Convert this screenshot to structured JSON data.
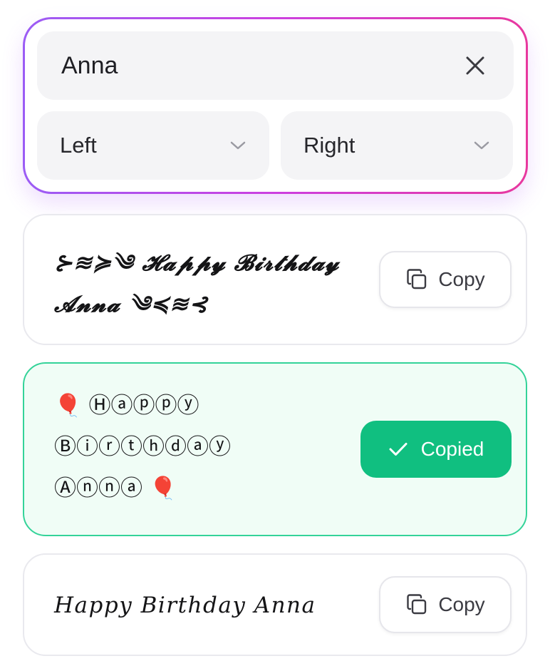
{
  "form": {
    "name_value": "Anna",
    "left_select": "Left",
    "right_select": "Right"
  },
  "results": [
    {
      "text": "⊱≋≽༄ 𝓗𝓪𝓹𝓹𝔂 𝓑𝓲𝓻𝓽𝓱𝓭𝓪𝔂 𝓐𝓷𝓷𝓪 ༄≼≋⊰",
      "button_label": "Copy",
      "state": "idle"
    },
    {
      "text": "🎈 Ⓗⓐⓟⓟⓨ Ⓑⓘⓡⓣⓗⓓⓐⓨ Ⓐⓝⓝⓐ 🎈",
      "button_label": "Copied",
      "state": "copied"
    },
    {
      "text": "𝐻𝑎𝑝𝑝𝑦 𝐵𝑖𝑟𝑡ℎ𝑑𝑎𝑦 𝐴𝑛𝑛𝑎",
      "button_label": "Copy",
      "state": "idle"
    }
  ],
  "icons": {
    "clear": "close-icon",
    "dropdown": "chevron-down-icon",
    "copy": "copy-icon",
    "copied": "check-icon"
  },
  "colors": {
    "gradient_start": "#9b5cf5",
    "gradient_end": "#e8389e",
    "success": "#10bf80",
    "success_bg": "#f0fdf6",
    "success_border": "#34d399"
  }
}
